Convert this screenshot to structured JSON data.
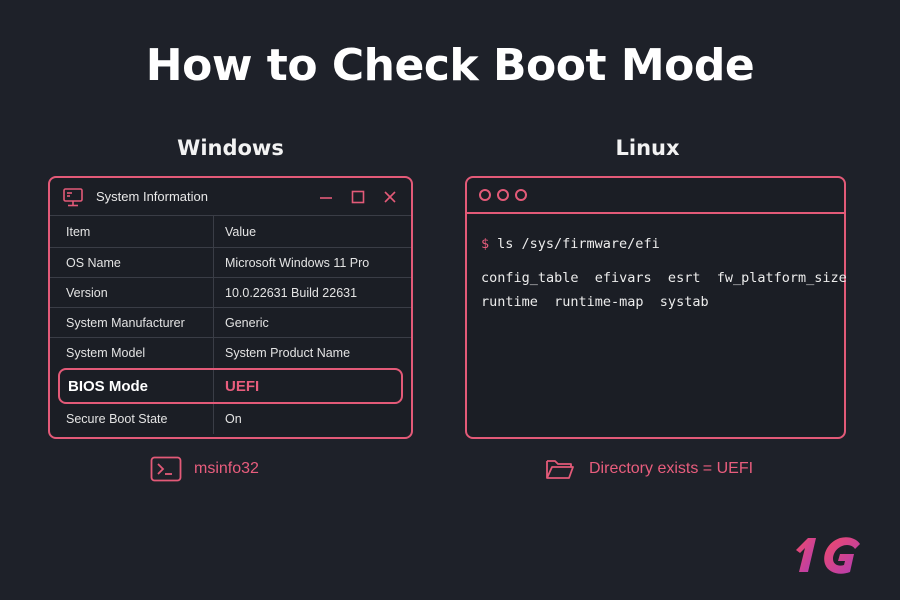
{
  "title": "How to Check Boot Mode",
  "windows": {
    "heading": "Windows",
    "window_title": "System Information",
    "table": {
      "headers": [
        "Item",
        "Value"
      ],
      "rows": [
        {
          "item": "OS Name",
          "value": "Microsoft Windows 11 Pro"
        },
        {
          "item": "Version",
          "value": "10.0.22631 Build 22631"
        },
        {
          "item": "System Manufacturer",
          "value": "Generic"
        },
        {
          "item": "System Model",
          "value": "System Product Name"
        },
        {
          "item": "BIOS Mode",
          "value": "UEFI"
        },
        {
          "item": "Secure Boot State",
          "value": "On"
        }
      ]
    },
    "caption": "msinfo32",
    "caption_icon": "terminal-icon"
  },
  "linux": {
    "heading": "Linux",
    "prompt": "$",
    "command": "ls /sys/firmware/efi",
    "output": [
      "config_table  efivars  esrt  fw_platform_size",
      "runtime  runtime-map  systab"
    ],
    "caption": "Directory exists = UEFI",
    "caption_icon": "folder-icon"
  },
  "logo_text": "1G",
  "colors": {
    "background": "#1e2129",
    "accent": "#e35a78",
    "text": "#ffffff"
  }
}
